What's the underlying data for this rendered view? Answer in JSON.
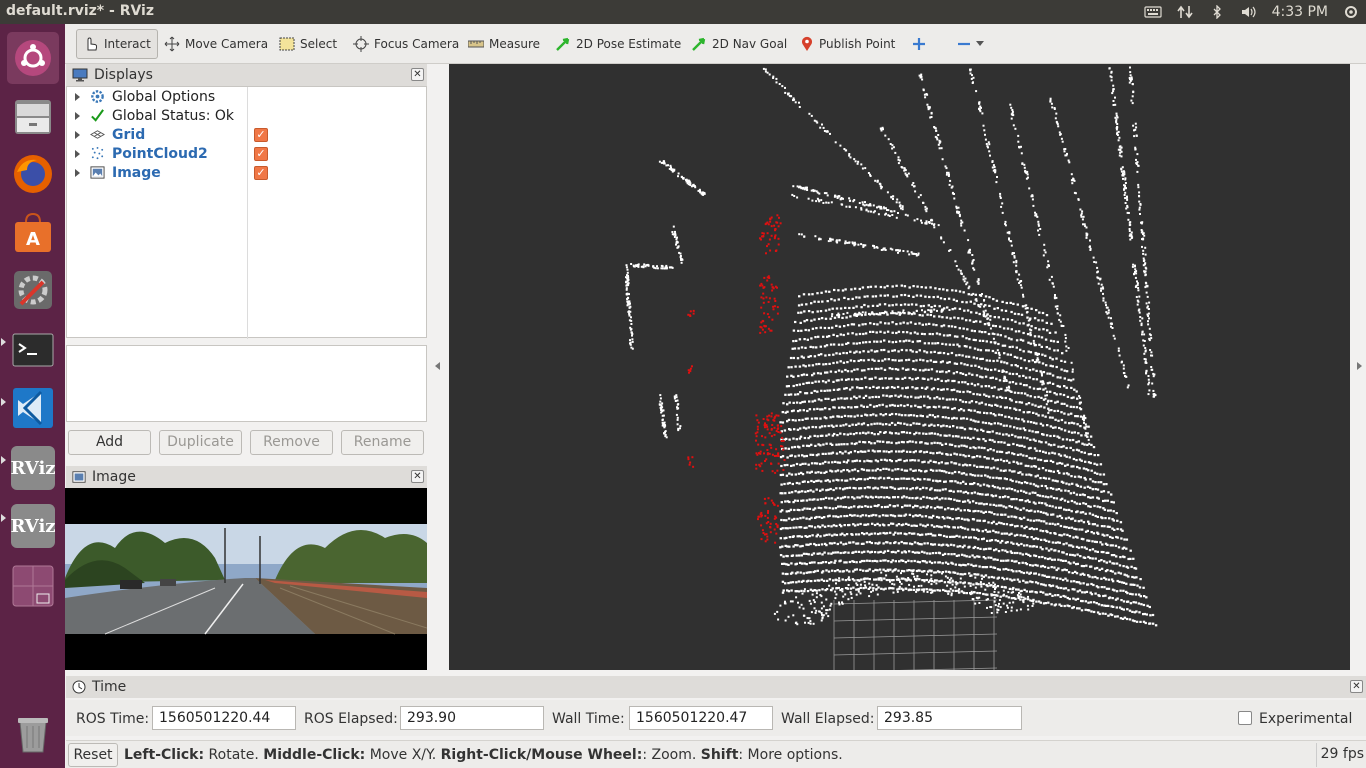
{
  "window": {
    "title": "default.rviz* - RViz"
  },
  "tray": {
    "time": "4:33 PM"
  },
  "toolbar": {
    "interact": "Interact",
    "move_camera": "Move Camera",
    "select": "Select",
    "focus_camera": "Focus Camera",
    "measure": "Measure",
    "pose_estimate": "2D Pose Estimate",
    "nav_goal": "2D Nav Goal",
    "publish_point": "Publish Point"
  },
  "displays": {
    "title": "Displays",
    "items": [
      {
        "label": "Global Options",
        "icon": "gear-icon",
        "checked": null
      },
      {
        "label": "Global Status: Ok",
        "icon": "checkmark-icon",
        "checked": null
      },
      {
        "label": "Grid",
        "icon": "grid-icon",
        "checked": true
      },
      {
        "label": "PointCloud2",
        "icon": "pointcloud-icon",
        "checked": true
      },
      {
        "label": "Image",
        "icon": "image-icon",
        "checked": true
      }
    ],
    "buttons": {
      "add": "Add",
      "duplicate": "Duplicate",
      "remove": "Remove",
      "rename": "Rename"
    }
  },
  "image_panel": {
    "title": "Image"
  },
  "time_panel": {
    "title": "Time",
    "ros_time_label": "ROS Time:",
    "ros_time": "1560501220.44",
    "ros_elapsed_label": "ROS Elapsed:",
    "ros_elapsed": "293.90",
    "wall_time_label": "Wall Time:",
    "wall_time": "1560501220.47",
    "wall_elapsed_label": "Wall Elapsed:",
    "wall_elapsed": "293.85",
    "experimental": "Experimental"
  },
  "status": {
    "reset": "Reset",
    "left_click_key": "Left-Click:",
    "left_click_val": " Rotate. ",
    "middle_click_key": "Middle-Click:",
    "middle_click_val": " Move X/Y. ",
    "right_click_key": "Right-Click/Mouse Wheel:",
    "right_click_val": ": Zoom. ",
    "shift_key": "Shift",
    "shift_val": ": More options.",
    "fps": "29 fps"
  },
  "colors": {
    "launcher": "#5c2346",
    "viewport_bg": "#303030",
    "point_white": "#ffffff",
    "point_red": "#e01010",
    "accent_orange": "#f07746"
  }
}
